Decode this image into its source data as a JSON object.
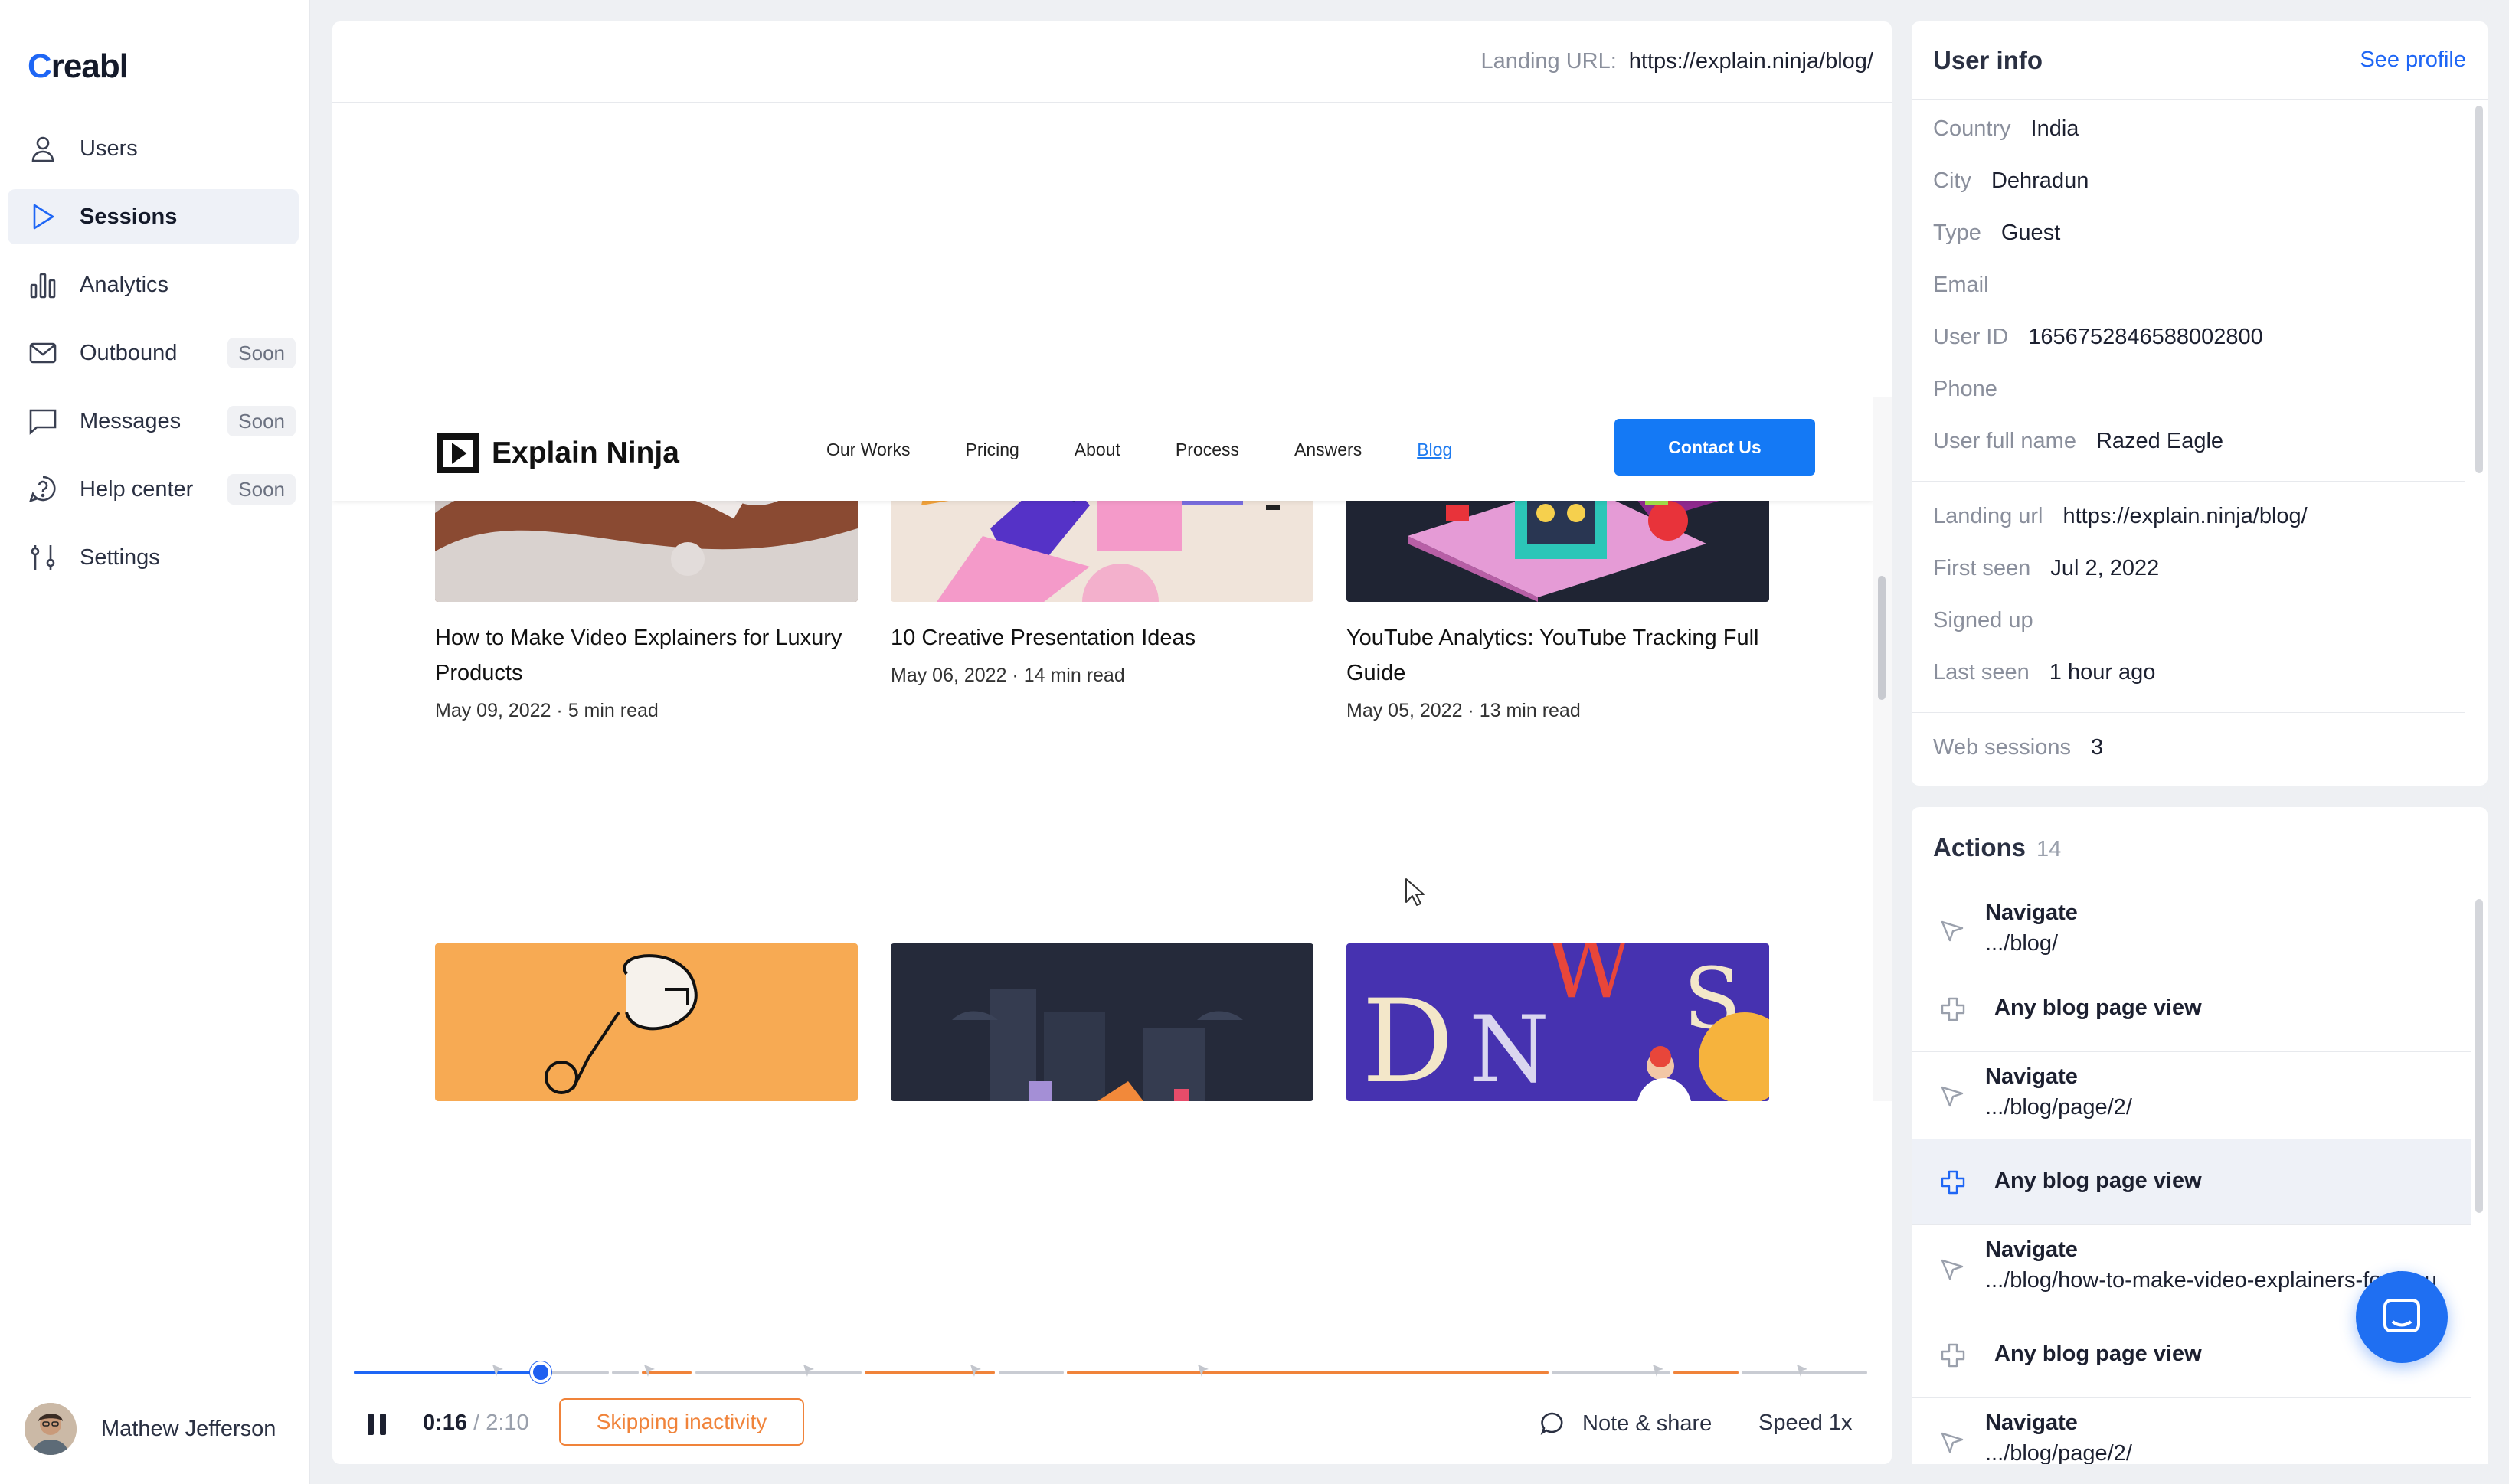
{
  "sidebar": {
    "logo": "Creabl",
    "items": [
      {
        "label": "Users",
        "icon": "user-icon"
      },
      {
        "label": "Sessions",
        "icon": "play-icon"
      },
      {
        "label": "Analytics",
        "icon": "bar-chart-icon"
      },
      {
        "label": "Outbound",
        "icon": "mail-icon",
        "badge": "Soon"
      },
      {
        "label": "Messages",
        "icon": "message-icon",
        "badge": "Soon"
      },
      {
        "label": "Help center",
        "icon": "help-icon",
        "badge": "Soon"
      },
      {
        "label": "Settings",
        "icon": "sliders-icon"
      }
    ],
    "user_name": "Mathew Jefferson"
  },
  "player": {
    "landing_label": "Landing URL:",
    "landing_url": "https://explain.ninja/blog/",
    "site": {
      "logo": "Explain Ninja",
      "nav": [
        "Our Works",
        "Pricing",
        "About",
        "Process",
        "Answers",
        "Blog"
      ],
      "contact": "Contact Us",
      "cards": [
        {
          "title": "How to Make Video Explainers for Luxury Products",
          "meta": "May 09, 2022 · 5 min read"
        },
        {
          "title": "10 Creative Presentation Ideas",
          "meta": "May 06, 2022 · 14 min read"
        },
        {
          "title": "YouTube Analytics: YouTube Tracking Full Guide",
          "meta": "May 05, 2022 · 13 min read"
        }
      ]
    },
    "time_current": "0:16",
    "time_total": "/ 2:10",
    "progress": 0.123,
    "skip_label": "Skipping inactivity",
    "note_label": "Note & share",
    "speed_label": "Speed 1x"
  },
  "user_info": {
    "title": "User info",
    "see_profile": "See profile",
    "rows": [
      {
        "k": "Country",
        "v": "India"
      },
      {
        "k": "City",
        "v": "Dehradun"
      },
      {
        "k": "Type",
        "v": "Guest"
      },
      {
        "k": "Email",
        "v": ""
      },
      {
        "k": "User ID",
        "v": "1656752846588002800"
      },
      {
        "k": "Phone",
        "v": ""
      },
      {
        "k": "User full name",
        "v": "Razed Eagle"
      },
      {
        "k": "Landing url",
        "v": "https://explain.ninja/blog/"
      },
      {
        "k": "First seen",
        "v": "Jul 2, 2022"
      },
      {
        "k": "Signed up",
        "v": ""
      },
      {
        "k": "Last seen",
        "v": "1 hour ago"
      },
      {
        "k": "Web sessions",
        "v": "3"
      }
    ]
  },
  "actions": {
    "title": "Actions",
    "count": "14",
    "items": [
      {
        "type": "navigate",
        "label": "Navigate",
        "path": ".../blog/"
      },
      {
        "type": "event",
        "label": "Any blog page view"
      },
      {
        "type": "navigate",
        "label": "Navigate",
        "path": ".../blog/page/2/"
      },
      {
        "type": "event",
        "label": "Any blog page view"
      },
      {
        "type": "navigate",
        "label": "Navigate",
        "path": ".../blog/how-to-make-video-explainers-for-luxu"
      },
      {
        "type": "event",
        "label": "Any blog page view"
      },
      {
        "type": "navigate",
        "label": "Navigate",
        "path": ".../blog/page/2/"
      }
    ]
  },
  "colors": {
    "accent": "#1e66f5",
    "orange": "#f0833a",
    "timeline_gray": "#c9ccd3"
  }
}
